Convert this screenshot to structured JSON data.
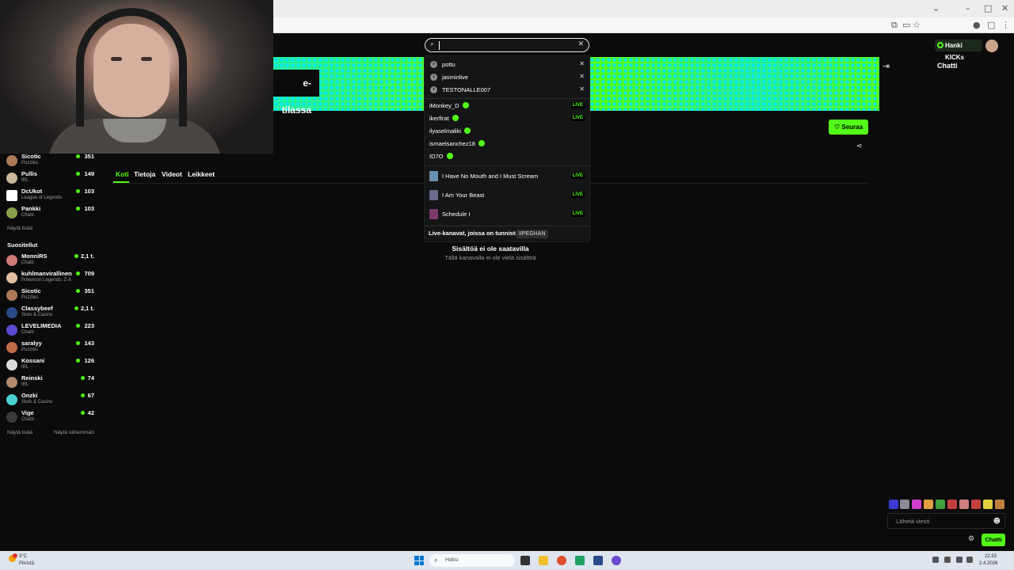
{
  "browser": {
    "window_controls": [
      "–",
      "□",
      "✕"
    ],
    "chevron": "⌄",
    "toolbar_icons": [
      "translate-icon",
      "cast-icon",
      "star-icon",
      "profile-icon",
      "extensions-icon",
      "menu-icon"
    ]
  },
  "search": {
    "placeholder": "",
    "value": "",
    "recent": [
      "pottu",
      "jasminlive",
      "TESTONALLE007"
    ],
    "channels": [
      {
        "name": "iMonkey_D",
        "verified": true,
        "live": true
      },
      {
        "name": "ikerfirat",
        "verified": true,
        "live": true
      },
      {
        "name": "ilyaselmaliki",
        "verified": true,
        "live": false
      },
      {
        "name": "ismaelsanchez18",
        "verified": true,
        "live": false
      },
      {
        "name": "ID7O",
        "verified": true,
        "live": false
      }
    ],
    "games": [
      {
        "name": "I Have No Mouth and I Must Scream",
        "live": true,
        "color": "#6a8fb0"
      },
      {
        "name": "I Am Your Beast",
        "live": true,
        "color": "#6a6a8a"
      },
      {
        "name": "Schedule I",
        "live": true,
        "color": "#7a3b6a"
      }
    ],
    "live_label": "LIVE",
    "tag_text": "Live-kanavat, joissa on tunniste",
    "tag_pill": "IIPEGHAN"
  },
  "header": {
    "promo_label": "Hanki KICKs"
  },
  "banner": {
    "label_fragment": "e-tilassa"
  },
  "channel": {
    "follow_label": "Seuraa",
    "tabs": [
      "Koti",
      "Tietoja",
      "Videot",
      "Leikkeet"
    ],
    "empty_title": "Sisältöä ei ole saatavilla",
    "empty_subtitle": "Tällä kanavalla ei ole vielä sisältöä"
  },
  "sidebar": {
    "followed": [
      {
        "name": "Sicotic",
        "category": "Puzzles",
        "viewers": "351",
        "color": "#b07a5a"
      },
      {
        "name": "Pullis",
        "category": "IRL",
        "viewers": "149",
        "color": "#c9b89a"
      },
      {
        "name": "DcUkot",
        "category": "League of Legends",
        "viewers": "103",
        "color": "#ffffff"
      },
      {
        "name": "Pankki",
        "category": "Chatti",
        "viewers": "103",
        "color": "#8aa04a"
      }
    ],
    "show_more": "Näytä lisää",
    "recommended_title": "Suositellut",
    "recommended": [
      {
        "name": "MonniRS",
        "category": "Chatti",
        "viewers": "2,1 t.",
        "color": "#d07a7a"
      },
      {
        "name": "kuhlmanvirallinen",
        "category": "Pokemon Legends: Z-A",
        "viewers": "709",
        "color": "#e0c0a0"
      },
      {
        "name": "Sicotic",
        "category": "Puzzles",
        "viewers": "351",
        "color": "#b07a5a"
      },
      {
        "name": "Classybeef",
        "category": "Slots & Casino",
        "viewers": "2,1 t.",
        "color": "#2a4a8a"
      },
      {
        "name": "LEVELIMEDIA",
        "category": "Chatti",
        "viewers": "223",
        "color": "#5a4ad0"
      },
      {
        "name": "saralyy",
        "category": "Puzzles",
        "viewers": "143",
        "color": "#c06a4a"
      },
      {
        "name": "Kossani",
        "category": "IRL",
        "viewers": "126",
        "color": "#dadada"
      },
      {
        "name": "Reinski",
        "category": "IRL",
        "viewers": "74",
        "color": "#b08a6a"
      },
      {
        "name": "Onzki",
        "category": "Slots & Casino",
        "viewers": "67",
        "color": "#4ad0d0"
      },
      {
        "name": "Vige",
        "category": "Chatti",
        "viewers": "42",
        "color": "#3a3a3a"
      }
    ],
    "show_more_2": "Näytä lisää",
    "show_less": "Näytä vähemmän"
  },
  "chat": {
    "title": "Chatti",
    "input_placeholder": "Lähetä viesti",
    "send_label": "Chatti",
    "emote_colors": [
      "#3a3ad0",
      "#8a8a9a",
      "#d040d0",
      "#e0a040",
      "#40a040",
      "#c04040",
      "#d08080",
      "#c04040",
      "#e0d040",
      "#c08040"
    ]
  },
  "taskbar": {
    "temperature": "3°C",
    "weather": "Pilvistä",
    "search_placeholder": "Haku",
    "time": "22.53",
    "date": "2.4.2026",
    "app_colors": [
      "#333333",
      "#f0c030",
      "#e05030",
      "#20a060",
      "#2a4a8a",
      "#6a4ad0"
    ]
  }
}
